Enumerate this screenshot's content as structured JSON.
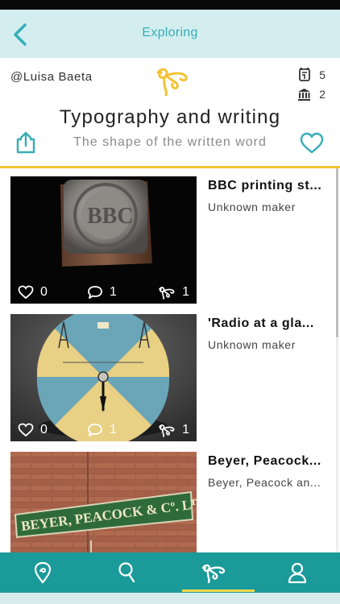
{
  "nav": {
    "title": "Exploring",
    "back_icon": "chevron-left-icon"
  },
  "collection": {
    "author": "@Luisa Baeta",
    "title": "Typography and writing",
    "subtitle": "The shape of the written word",
    "objects_count": "5",
    "museums_count": "2"
  },
  "items": [
    {
      "title": "BBC printing st...",
      "maker": "Unknown maker",
      "likes": "0",
      "comments": "1",
      "collections": "1"
    },
    {
      "title": "'Radio at a gla...",
      "maker": "Unknown maker",
      "likes": "0",
      "comments": "1",
      "collections": "1"
    },
    {
      "title": "Beyer, Peacock...",
      "maker": "Beyer, Peacock an...",
      "sign_text": "BEYER, PEACOCK & Cº. Lᵀᴰ"
    }
  ],
  "tabs": [
    {
      "icon": "map-pin-icon",
      "active": false
    },
    {
      "icon": "search-icon",
      "active": false
    },
    {
      "icon": "explore-logo-icon",
      "active": true
    },
    {
      "icon": "profile-icon",
      "active": false
    }
  ],
  "colors": {
    "accent": "#35aeb6",
    "nav_bg": "#d4eef0",
    "tabbar": "#1b9a9a",
    "highlight": "#f3c332",
    "active_tab_indicator": "#f3d94c"
  }
}
